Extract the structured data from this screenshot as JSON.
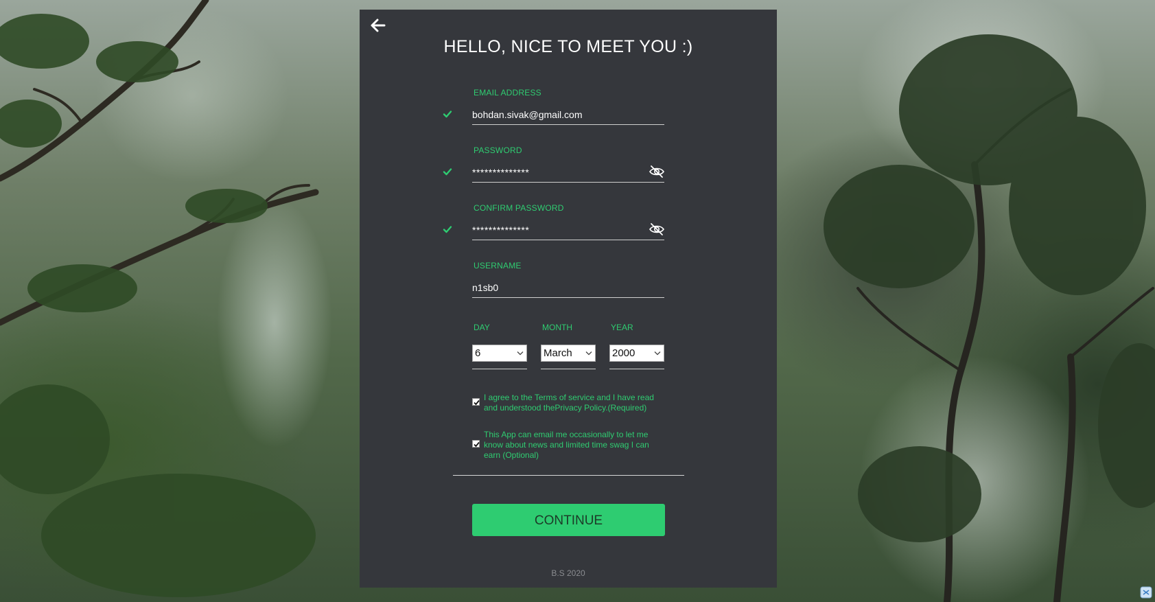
{
  "header": {
    "title": "HELLO, NICE TO MEET YOU :)"
  },
  "form": {
    "email": {
      "label": "EMAIL ADDRESS",
      "value": "bohdan.sivak@gmail.com",
      "valid": true
    },
    "password": {
      "label": "PASSWORD",
      "value": "**************",
      "valid": true
    },
    "confirm_password": {
      "label": "CONFIRM PASSWORD",
      "value": "**************",
      "valid": true
    },
    "username": {
      "label": "USERNAME",
      "value": "n1sb0"
    },
    "birthdate": {
      "day": {
        "label": "DAY",
        "value": "6"
      },
      "month": {
        "label": "MONTH",
        "value": "March"
      },
      "year": {
        "label": "YEAR",
        "value": "2000"
      }
    },
    "terms_checkbox": {
      "checked": true,
      "line1": "I agree to the Terms of service and I have read",
      "line2": "and understood thePrivacy Policy.(Required)"
    },
    "email_opt_in_checkbox": {
      "checked": true,
      "line1": "This App can email me occasionally to let me",
      "line2": "know about news and limited time swag I can",
      "line3": "earn (Optional)"
    },
    "continue_label": "CONTINUE"
  },
  "footer": {
    "text": "B.S 2020"
  },
  "colors": {
    "accent": "#2ecc71",
    "panel": "#35373c",
    "text": "#ffffff"
  },
  "icons": [
    "back-arrow-icon",
    "check-icon",
    "eye-hidden-icon",
    "chevron-down-icon"
  ]
}
